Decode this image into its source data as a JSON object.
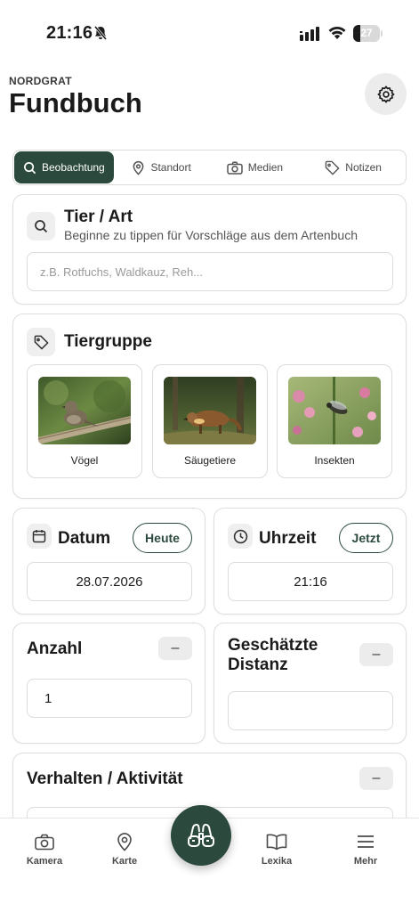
{
  "status_bar": {
    "time": "21:16",
    "battery": "27",
    "battery_level": 0.27
  },
  "header": {
    "kicker": "NORDGRAT",
    "title": "Fundbuch"
  },
  "tabs": [
    {
      "label": "Beobachtung",
      "icon": "search-icon",
      "active": true
    },
    {
      "label": "Standort",
      "icon": "location-pin-icon",
      "active": false
    },
    {
      "label": "Medien",
      "icon": "camera-icon",
      "active": false
    },
    {
      "label": "Notizen",
      "icon": "tag-icon",
      "active": false
    }
  ],
  "species": {
    "title": "Tier / Art",
    "subtitle": "Beginne zu tippen für Vorschläge aus dem Artenbuch",
    "placeholder": "z.B. Rotfuchs, Waldkauz, Reh..."
  },
  "animal_group": {
    "title": "Tiergruppe",
    "options": [
      {
        "label": "Vögel",
        "icon": "bird-photo"
      },
      {
        "label": "Säugetiere",
        "icon": "mammal-photo"
      },
      {
        "label": "Insekten",
        "icon": "insect-photo"
      }
    ]
  },
  "date": {
    "title": "Datum",
    "today_button": "Heute",
    "value": "28.07.2026"
  },
  "time": {
    "title": "Uhrzeit",
    "now_button": "Jetzt",
    "value": "21:16"
  },
  "count": {
    "title": "Anzahl",
    "minus": "–",
    "value": "1"
  },
  "distance": {
    "title_line1": "Geschätzte",
    "title_line2": "Distanz",
    "minus": "–",
    "value": ""
  },
  "behavior": {
    "title": "Verhalten / Aktivität",
    "minus": "–"
  },
  "bottom_nav": [
    {
      "label": "Kamera",
      "icon": "camera-icon"
    },
    {
      "label": "Karte",
      "icon": "map-pin-icon"
    },
    {
      "label": "Lexika",
      "icon": "book-icon"
    },
    {
      "label": "Mehr",
      "icon": "menu-icon"
    }
  ],
  "colors": {
    "accent": "#2b4a3d",
    "card_border": "#dedede",
    "chip_bg": "#efefef"
  }
}
